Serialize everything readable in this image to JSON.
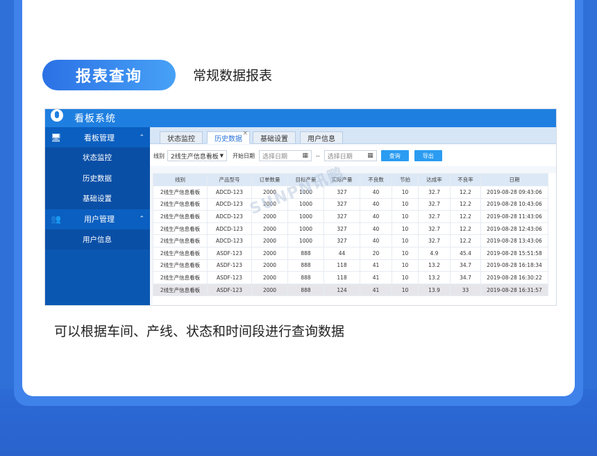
{
  "section_title": "报表查询",
  "section_subtitle": "常规数据报表",
  "caption": "可以根据车间、产线、状态和时间段进行查询数据",
  "app": {
    "title": "看板系统",
    "sidebar": {
      "groups": [
        {
          "icon": "monitor-icon",
          "label": "看板管理",
          "items": [
            "状态监控",
            "历史数据",
            "基础设置"
          ]
        },
        {
          "icon": "users-icon",
          "label": "用户管理",
          "items": [
            "用户信息"
          ]
        }
      ]
    },
    "tabs": [
      "状态监控",
      "历史数据",
      "基础设置",
      "用户信息"
    ],
    "active_tab": "历史数据",
    "filter": {
      "line_label": "线别",
      "line_value": "2线生产信息看板",
      "start_label": "开始日期",
      "start_placeholder": "选择日期",
      "range_sep": "--",
      "end_placeholder": "选择日期",
      "query_btn": "查询",
      "export_btn": "导出"
    },
    "table": {
      "columns": [
        "线别",
        "产品型号",
        "订单数量",
        "目标产量",
        "实际产量",
        "不良数",
        "节拍",
        "达成率",
        "不良率",
        "日期"
      ],
      "rows": [
        [
          "2线生产信息看板",
          "ADCD-123",
          "2000",
          "1000",
          "327",
          "40",
          "10",
          "32.7",
          "12.2",
          "2019-08-28 09:43:06"
        ],
        [
          "2线生产信息看板",
          "ADCD-123",
          "2000",
          "1000",
          "327",
          "40",
          "10",
          "32.7",
          "12.2",
          "2019-08-28 10:43:06"
        ],
        [
          "2线生产信息看板",
          "ADCD-123",
          "2000",
          "1000",
          "327",
          "40",
          "10",
          "32.7",
          "12.2",
          "2019-08-28 11:43:06"
        ],
        [
          "2线生产信息看板",
          "ADCD-123",
          "2000",
          "1000",
          "327",
          "40",
          "10",
          "32.7",
          "12.2",
          "2019-08-28 12:43:06"
        ],
        [
          "2线生产信息看板",
          "ADCD-123",
          "2000",
          "1000",
          "327",
          "40",
          "10",
          "32.7",
          "12.2",
          "2019-08-28 13:43:06"
        ],
        [
          "2线生产信息看板",
          "ASDF-123",
          "2000",
          "888",
          "44",
          "20",
          "10",
          "4.9",
          "45.4",
          "2019-08-28 15:51:58"
        ],
        [
          "2线生产信息看板",
          "ASDF-123",
          "2000",
          "888",
          "118",
          "41",
          "10",
          "13.2",
          "34.7",
          "2019-08-28 16:18:34"
        ],
        [
          "2线生产信息看板",
          "ASDF-123",
          "2000",
          "888",
          "118",
          "41",
          "10",
          "13.2",
          "34.7",
          "2019-08-28 16:30:22"
        ],
        [
          "2线生产信息看板",
          "ASDF-123",
          "2000",
          "888",
          "124",
          "41",
          "10",
          "13.9",
          "33",
          "2019-08-28 16:31:57"
        ]
      ],
      "highlighted_row": 8
    },
    "watermark": "SUNPN讯鹏"
  },
  "colors": {
    "accent": "#2b71e5",
    "header": "#1f7fe0",
    "sidebar": "#0a57b2",
    "button": "#2b9cf2"
  }
}
